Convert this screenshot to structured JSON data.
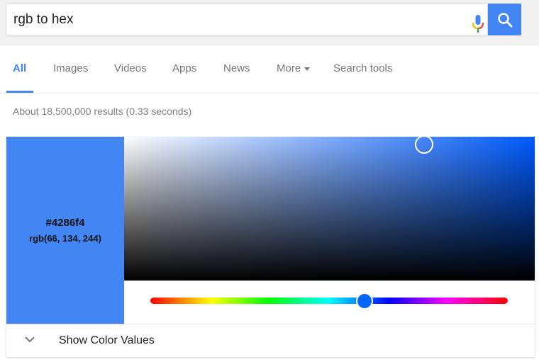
{
  "search": {
    "query": "rgb to hex",
    "mic_icon": "microphone-icon",
    "search_icon": "magnifier-icon",
    "button_color": "#4285f4"
  },
  "tabs": [
    {
      "label": "All",
      "active": true
    },
    {
      "label": "Images"
    },
    {
      "label": "Videos"
    },
    {
      "label": "Apps"
    },
    {
      "label": "News"
    },
    {
      "label": "More"
    },
    {
      "label": "Search tools"
    }
  ],
  "result_stats": "About 18,500,000 results (0.33 seconds)",
  "color_picker": {
    "hex": "#4286f4",
    "rgb": "rgb(66, 134, 244)",
    "swatch_color": "#4286f4",
    "hue_fraction": 0.6,
    "show_values_label": "Show Color Values",
    "chevron_icon": "chevron-down-icon"
  }
}
